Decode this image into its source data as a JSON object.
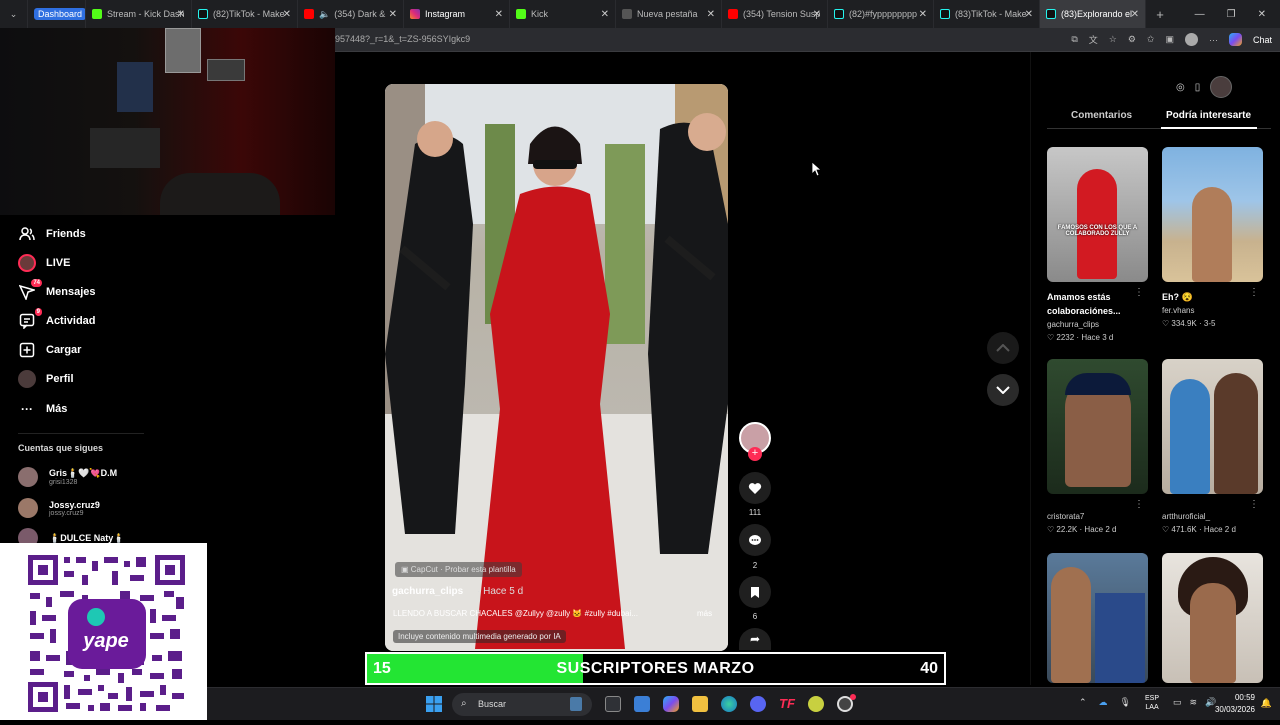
{
  "browser": {
    "tabs": [
      {
        "label": "Dashboard",
        "favicon": "dashboard-badge"
      },
      {
        "label": "Stream - Kick Dash",
        "favicon": "kick-icon"
      },
      {
        "label": "(82)TikTok - Make",
        "favicon": "tiktok-icon"
      },
      {
        "label": "(354) Dark &",
        "favicon": "youtube-icon"
      },
      {
        "label": "Instagram",
        "favicon": "instagram-icon"
      },
      {
        "label": "Kick",
        "favicon": "kick-icon"
      },
      {
        "label": "Nueva pestaña",
        "favicon": "page-icon"
      },
      {
        "label": "(354) Tension Susp",
        "favicon": "youtube-icon"
      },
      {
        "label": "(82)#fypppppppp",
        "favicon": "tiktok-icon"
      },
      {
        "label": "(83)TikTok - Make",
        "favicon": "tiktok-icon"
      },
      {
        "label": "(83)Explorando el",
        "favicon": "tiktok-icon"
      }
    ],
    "url": "957448?_r=1&_t=ZS-956SYIgkc9",
    "chat_label": "Chat"
  },
  "nav": {
    "items": [
      {
        "label": "Friends",
        "icon": "friends-icon"
      },
      {
        "label": "LIVE",
        "icon": "live-icon"
      },
      {
        "label": "Mensajes",
        "icon": "messages-icon",
        "badge": "74"
      },
      {
        "label": "Actividad",
        "icon": "activity-icon",
        "badge": "9"
      },
      {
        "label": "Cargar",
        "icon": "upload-icon"
      },
      {
        "label": "Perfil",
        "icon": "profile-icon"
      },
      {
        "label": "Más",
        "icon": "more-icon"
      }
    ],
    "follows_heading": "Cuentas que sigues",
    "follows": [
      {
        "name": "Gris🕯️🤍💘D.M",
        "handle": "grisi1328"
      },
      {
        "name": "Jossy.cruz9",
        "handle": "jossy.cruz9"
      },
      {
        "name": "🕯️DULCE Naty🕯️",
        "handle": ""
      }
    ]
  },
  "video": {
    "capcut_tag": "CapCut · Probar esta plantilla",
    "author": "gachurra_clips",
    "age": "· Hace 5 d",
    "caption": "LLENDO A BUSCAR CHACALES @Zullyy @zully 🐱 #zully #dubai...",
    "more": "más",
    "ai_note": "Incluye contenido multimedia generado por IA",
    "likes": "111",
    "comments": "2",
    "saves": "6"
  },
  "right_panel": {
    "tabs": [
      "Comentarios",
      "Podría interesarte"
    ],
    "active_tab": "Podría interesarte",
    "cards": [
      {
        "title": "Amamos estás colaboraciónes...",
        "user": "gachurra_clips",
        "likes": "2232",
        "age": "Hace 3 d",
        "thumb_text": "FAMOSOS CON LOS QUE A COLABORADO ZULLY"
      },
      {
        "title": "Eh? 😵",
        "user": "fer.vhans",
        "likes": "334.9K",
        "age": "3-5",
        "thumb_text": ""
      },
      {
        "title": "",
        "user": "cristorata7",
        "likes": "22.2K",
        "age": "Hace 2 d",
        "thumb_text": ""
      },
      {
        "title": "",
        "user": "artthuroficial_",
        "likes": "471.6K",
        "age": "Hace 2 d",
        "thumb_text": ""
      },
      {
        "title": "",
        "user": "",
        "likes": "",
        "age": "",
        "thumb_text": ""
      },
      {
        "title": "",
        "user": "",
        "likes": "",
        "age": "",
        "thumb_text": ""
      }
    ]
  },
  "goal": {
    "current": "15",
    "title": "SUSCRIPTORES MARZO",
    "target": "40",
    "progress": 0.375,
    "fill_color": "#23e533"
  },
  "taskbar": {
    "search_label": "Buscar",
    "lang_line1": "ESP",
    "lang_line2": "LAA",
    "time": "00:59",
    "date": "30/03/2026"
  },
  "colors": {
    "tiktok_red": "#fe2c55",
    "goal_green": "#23e533",
    "yape_purple": "#6a1b9a"
  }
}
